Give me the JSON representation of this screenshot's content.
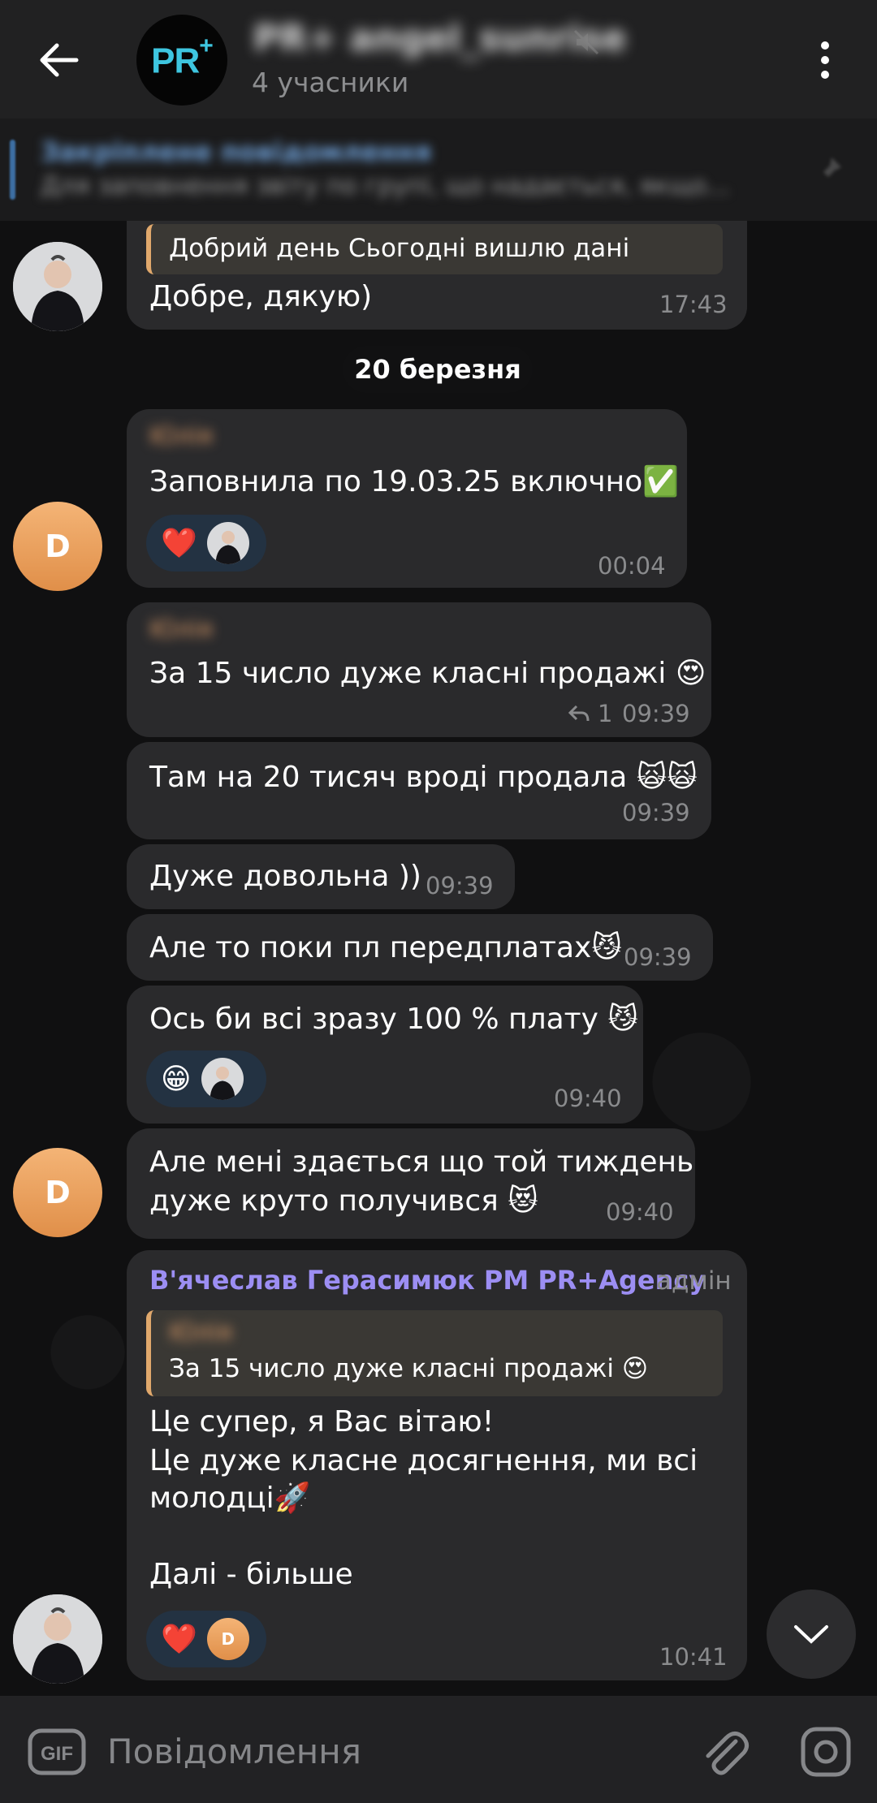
{
  "header": {
    "title": "PR+ angel_sunrise",
    "subtitle": "4 учасники",
    "logo_text": "PR",
    "logo_plus": "+"
  },
  "pinned": {
    "title": "Закріплене повідомлення",
    "text": "Для заповнення звіту по групі, що надається, якщо..."
  },
  "date_separator": "20 березня",
  "messages": [
    {
      "quote": "Добрий день  Сьогодні вишлю дані",
      "text": "Добре, дякую)",
      "time": "17:43"
    },
    {
      "sender": "Юлія",
      "text": "Заповнила по 19.03.25 включно✅",
      "time": "00:04",
      "reaction": "❤️",
      "avatar_letter": "D"
    },
    {
      "sender": "Юлія",
      "text": "За 15 число дуже класні продажі 😍",
      "reply_count": "1",
      "time": "09:39"
    },
    {
      "text": "Там на 20 тисяч вроді продала 🙀🙀",
      "time": "09:39"
    },
    {
      "text": "Дуже довольна ))",
      "time": "09:39"
    },
    {
      "text": "Але то поки пл передплатах😼",
      "time": "09:39"
    },
    {
      "text": "Ось би всі зразу 100 % плату 😼",
      "time": "09:40",
      "reaction": "😁"
    },
    {
      "line1": "Але мені здається що той тиждень",
      "line2": "дуже круто получився 😻",
      "time": "09:40",
      "avatar_letter": "D"
    },
    {
      "sender": "В'ячеслав Герасимюк PM PR+Agency",
      "admin_tag": "адмін",
      "quote_sender": "Юлія",
      "quote": "За 15 число дуже класні продажі 😍",
      "line1": "Це супер, я Вас вітаю!",
      "line2": "Це дуже класне досягнення, ми всі",
      "line3": "молодці🚀",
      "line4": "Далі - більше",
      "reaction": "❤️",
      "reaction_avatar": "D",
      "time": "10:41"
    }
  ],
  "input": {
    "placeholder": "Повідомлення",
    "gif_label": "GIF"
  }
}
